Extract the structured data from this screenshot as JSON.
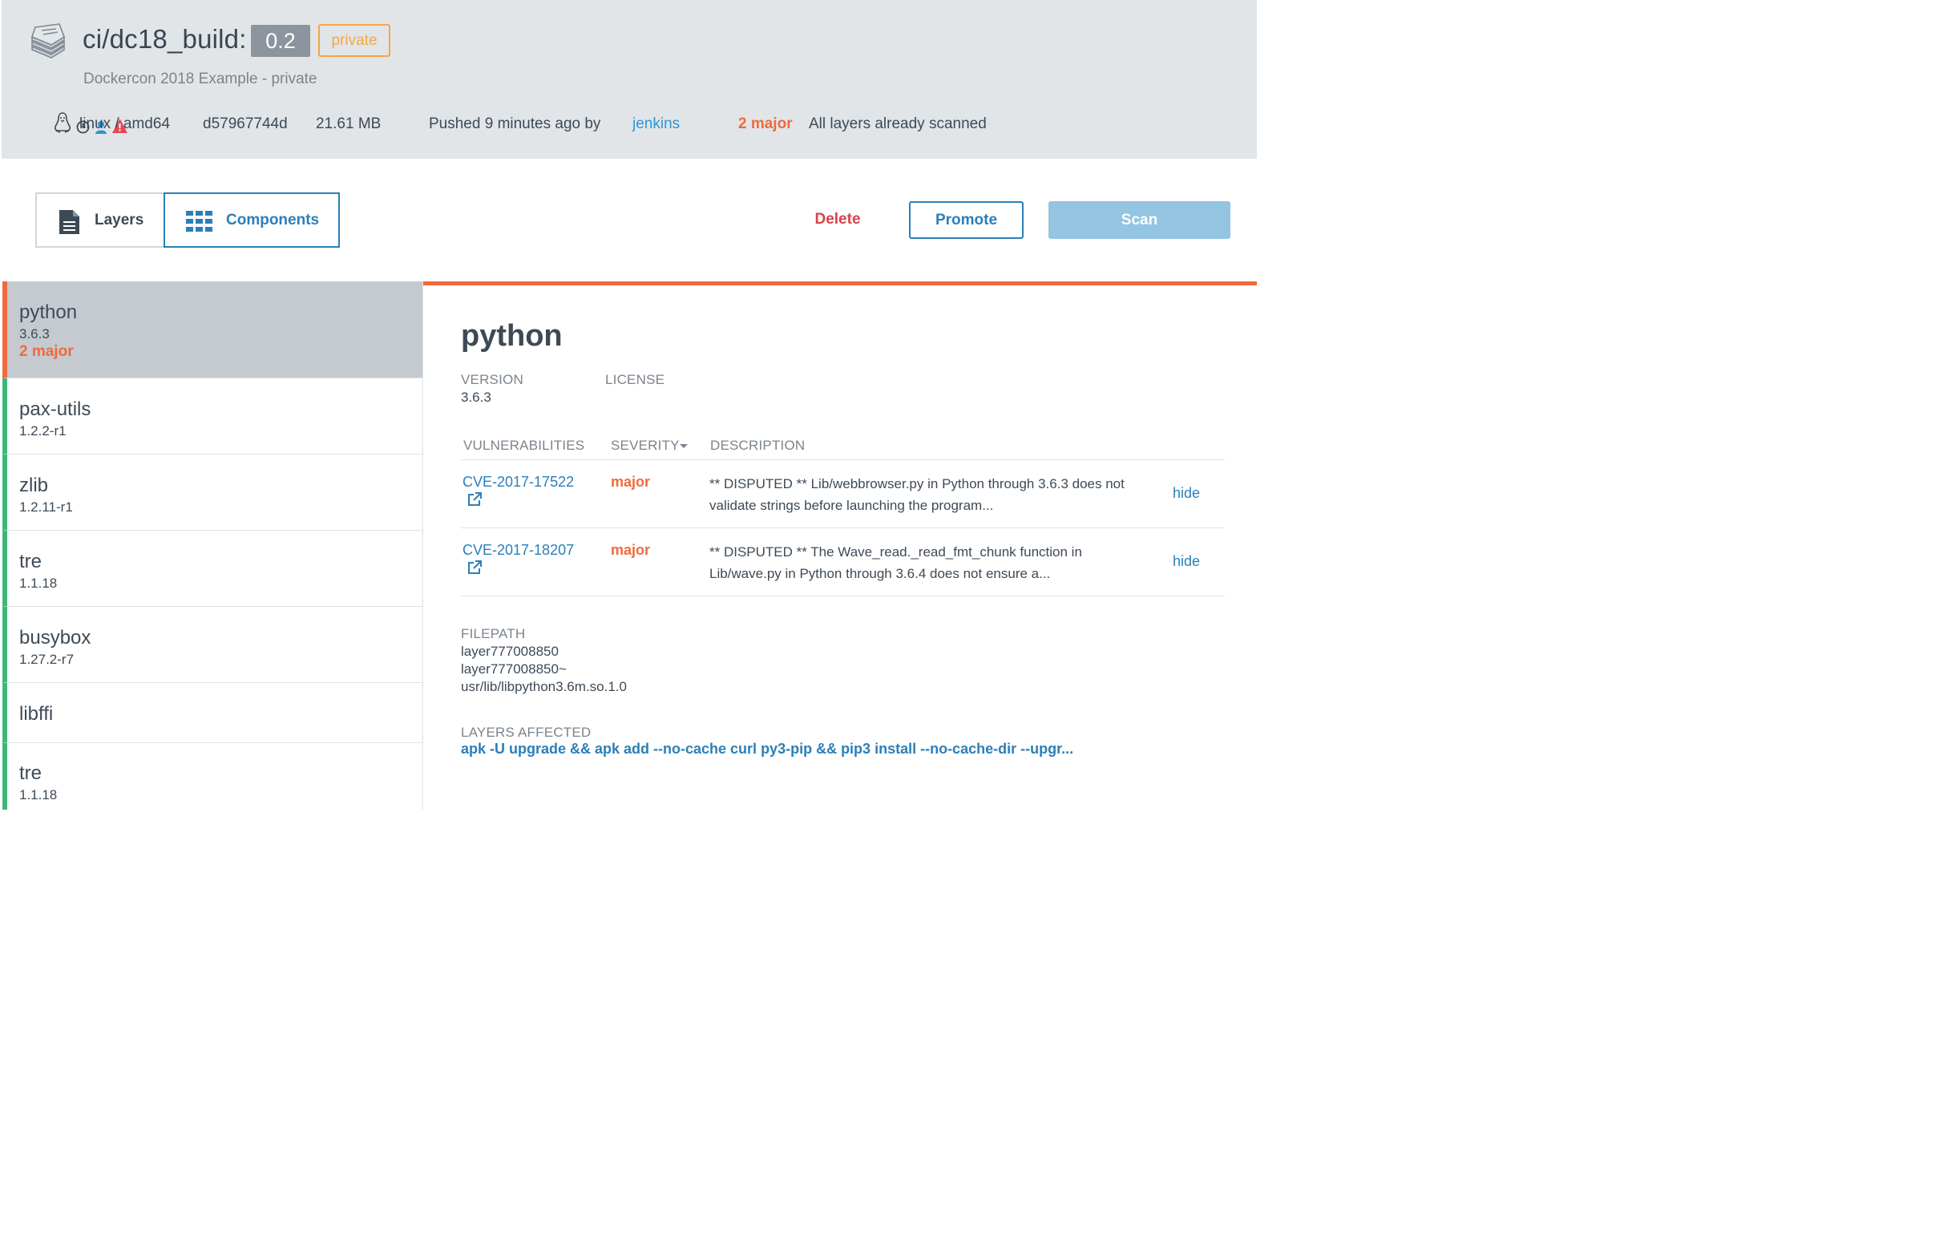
{
  "header": {
    "repo": "ci/dc18_build",
    "separator": ":",
    "tag": "0.2",
    "visibility": "private",
    "description": "Dockercon 2018 Example - private",
    "os_arch": "linux / amd64",
    "digest": "d57967744d",
    "size": "21.61 MB",
    "pushed": "Pushed 9 minutes ago by",
    "pushed_by": "jenkins",
    "vuln_summary": "2 major",
    "scan_status": "All layers already scanned",
    "icons": {
      "repo": "stacked-repo-icon",
      "os": "linux-penguin-icon",
      "time": "clock-icon",
      "user": "user-icon",
      "warning": "warning-triangle-icon"
    }
  },
  "tabs": [
    {
      "label": "Layers",
      "icon": "document-icon",
      "active": false
    },
    {
      "label": "Components",
      "icon": "grid-icon",
      "active": true
    }
  ],
  "actions": {
    "delete": "Delete",
    "promote": "Promote",
    "scan": "Scan"
  },
  "components": [
    {
      "name": "python",
      "version": "3.6.3",
      "severity": "2 major",
      "selected": true
    },
    {
      "name": "pax-utils",
      "version": "1.2.2-r1"
    },
    {
      "name": "zlib",
      "version": "1.2.11-r1"
    },
    {
      "name": "tre",
      "version": "1.1.18"
    },
    {
      "name": "busybox",
      "version": "1.27.2-r7"
    },
    {
      "name": "libffi",
      "version": ""
    },
    {
      "name": "tre",
      "version": "1.1.18"
    }
  ],
  "detail": {
    "title": "python",
    "version_label": "VERSION",
    "version": "3.6.3",
    "license_label": "LICENSE",
    "columns": {
      "vulnerabilities": "VULNERABILITIES",
      "severity": "SEVERITY",
      "description": "DESCRIPTION"
    },
    "vulnerabilities": [
      {
        "cve": "CVE-2017-17522",
        "severity": "major",
        "description": "** DISPUTED ** Lib/webbrowser.py in Python through 3.6.3 does not validate strings before launching the program...",
        "action": "hide"
      },
      {
        "cve": "CVE-2017-18207",
        "severity": "major",
        "description": "** DISPUTED ** The Wave_read._read_fmt_chunk function in Lib/wave.py in Python through 3.6.4 does not ensure a...",
        "action": "hide"
      }
    ],
    "filepath_label": "FILEPATH",
    "filepath": [
      "layer777008850",
      "layer777008850~",
      "usr/lib/libpython3.6m.so.1.0"
    ],
    "layers_label": "LAYERS AFFECTED",
    "layers": "apk -U upgrade && apk add --no-cache curl py3-pip && pip3 install --no-cache-dir --upgr..."
  },
  "colors": {
    "accent_orange": "#f06a3c",
    "link_blue": "#2b7fb8",
    "ok_green": "#3cb878",
    "header_bg": "#e1e5e8",
    "private_orange": "#f5a742"
  }
}
